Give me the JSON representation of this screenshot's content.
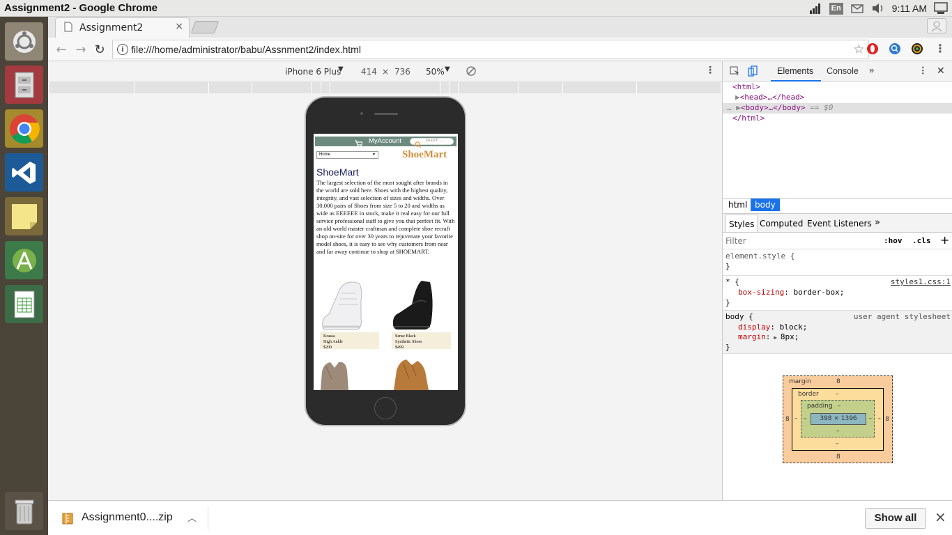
{
  "window": {
    "title": "Assignment2 - Google Chrome"
  },
  "tray": {
    "lang": "En",
    "clock": "9:11 AM"
  },
  "launcher": {
    "items": [
      "ubuntu-icon",
      "files-icon",
      "chrome-icon",
      "vscode-icon",
      "sticky-notes-icon",
      "android-studio-icon",
      "spreadsheet-icon",
      "trash-icon"
    ]
  },
  "tab": {
    "title": "Assignment2",
    "close": "×"
  },
  "omnibox": {
    "url": "file:///home/administrator/babu/Assnment2/index.html"
  },
  "device_toolbar": {
    "device": "iPhone 6 Plus",
    "width": "414",
    "times": "×",
    "height": "736",
    "zoom": "50%"
  },
  "site": {
    "account": "MyAccount",
    "search_placeholder": "search ....",
    "select_value": "Home",
    "brand": "ShoeMart",
    "heading": "ShoeMart",
    "paragraph": "The largest selection of the most sought after brands in the world are sold here. Shoes with the highest quality, integrity, and vast selection of sizes and widths. Over 30,000 pairs of Shoes from size 5 to 20 and widths as wide as EEEEEE in stock, make it real easy for our full service professional staff to give you that perfect fit. With an old world master craftman and complete shoe recraft shop on-site for over 30 years to rejuvenate your favorite model shoes, it is easy to see why customers from near and far away continue to shop at SHOEMART.",
    "products": [
      {
        "name": "Kraasa",
        "desc": "High Ankle",
        "price": "$200"
      },
      {
        "name": "Sense Black",
        "desc": "Synthetic Shoes",
        "price": "$499"
      }
    ]
  },
  "devtools": {
    "tabs": [
      "Elements",
      "Console"
    ],
    "dom": {
      "html_open": "<html>",
      "head": "<head>…</head>",
      "body": "<body>…</body>",
      "body_sel": "== $0",
      "html_close": "</html>"
    },
    "breadcrumb": [
      "html",
      "body"
    ],
    "subtabs": [
      "Styles",
      "Computed",
      "Event Listeners"
    ],
    "filter": {
      "placeholder": "Filter",
      "hov": ":hov",
      "cls": ".cls",
      "plus": "+"
    },
    "rules": {
      "element_style": "element.style {",
      "close": "}",
      "star_sel": "* {",
      "star_src": "styles1.css:1",
      "star_prop": "box-sizing",
      "star_val": "border-box;",
      "body_sel": "body {",
      "body_src": "user agent stylesheet",
      "body_prop1": "display",
      "body_val1": "block;",
      "body_prop2": "margin",
      "body_val2": "8px;"
    },
    "box": {
      "margin_label": "margin",
      "margin": "8",
      "border_label": "border",
      "border": "–",
      "padding_label": "padding",
      "padding": "–",
      "content": "398 × 1396"
    }
  },
  "downloads": {
    "file": "Assignment0....zip",
    "show_all": "Show all",
    "close": "×"
  }
}
